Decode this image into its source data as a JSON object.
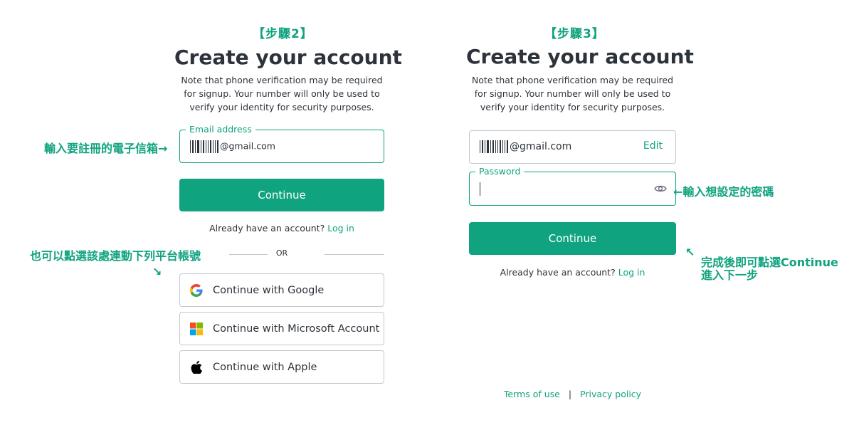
{
  "left": {
    "step": "【步驟2】",
    "title": "Create your account",
    "desc": "Note that phone verification may be required for signup. Your number will only be used to verify your identity for security purposes.",
    "email_label": "Email address",
    "email_value": "@gmail.com",
    "continue": "Continue",
    "already": "Already have an account?",
    "login": "Log in",
    "or": "OR",
    "social": [
      {
        "label": "Continue with Google",
        "icon": "google-icon"
      },
      {
        "label": "Continue with Microsoft Account",
        "icon": "microsoft-icon"
      },
      {
        "label": "Continue with Apple",
        "icon": "apple-icon"
      }
    ]
  },
  "right": {
    "step": "【步驟3】",
    "title": "Create your account",
    "desc": "Note that phone verification may be required for signup. Your number will only be used to verify your identity for security purposes.",
    "email_value": "@gmail.com",
    "edit": "Edit",
    "password_label": "Password",
    "continue": "Continue",
    "already": "Already have an account?",
    "login": "Log in",
    "terms": "Terms of use",
    "separator": "|",
    "privacy": "Privacy policy"
  },
  "annotations": {
    "email_hint": "輸入要註冊的電子信箱→",
    "social_hint": "也可以點選該處連動下列平台帳號",
    "social_arrow": "↘",
    "password_hint": "←輸入想設定的密碼",
    "continue_arrow": "↖",
    "continue_hint_line1": "完成後即可點選Continue",
    "continue_hint_line2": "進入下一步"
  },
  "colors": {
    "accent": "#10a37f",
    "text": "#2d333a",
    "border": "#c2c8d0"
  }
}
